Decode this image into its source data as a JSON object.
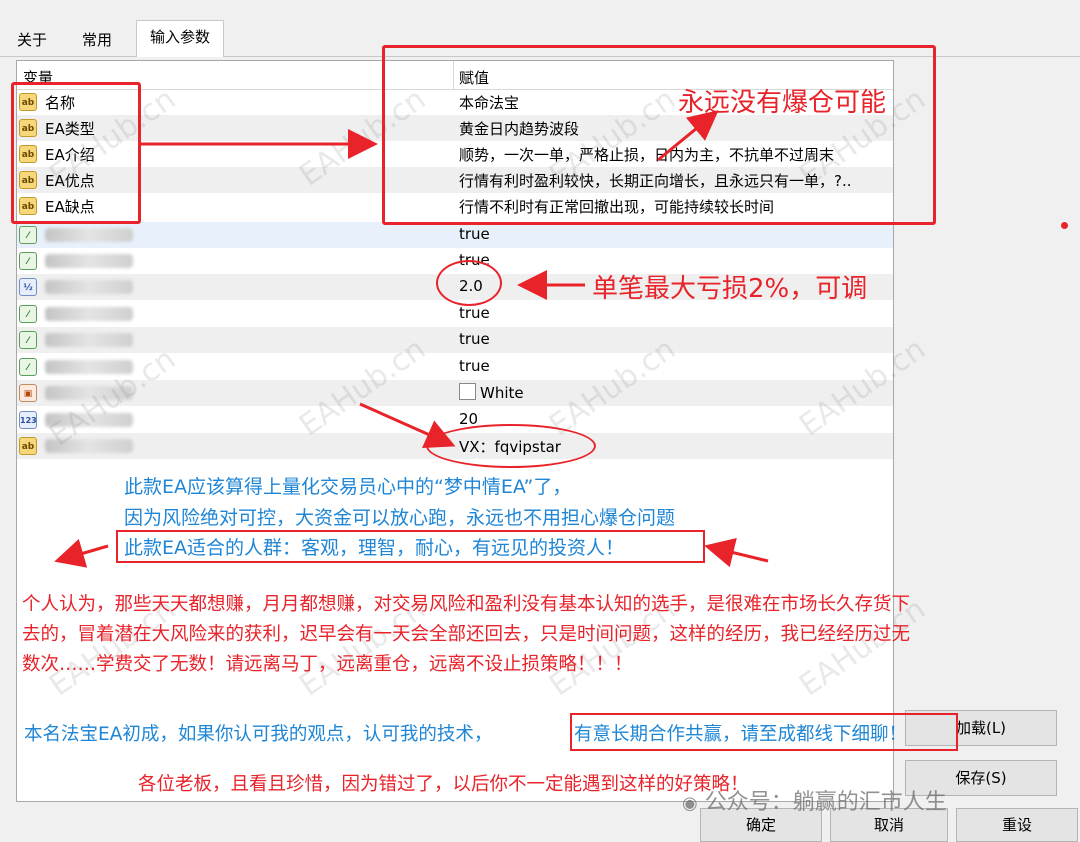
{
  "tabs": [
    {
      "label": "关于"
    },
    {
      "label": "常用"
    },
    {
      "label": "输入参数"
    }
  ],
  "columns": {
    "variable": "变量",
    "value": "赋值"
  },
  "rows": [
    {
      "name": "名称",
      "value": "本命法宝",
      "icon": "ab"
    },
    {
      "name": "EA类型",
      "value": "黄金日内趋势波段",
      "icon": "ab"
    },
    {
      "name": "EA介绍",
      "value": "顺势，一次一单，严格止损，日内为主，不抗单不过周末",
      "icon": "ab"
    },
    {
      "name": "EA优点",
      "value": "行情有利时盈利较快，长期正向增长，且永远只有一单，?..",
      "icon": "ab"
    },
    {
      "name": "EA缺点",
      "value": "行情不利时有正常回撤出现，可能持续较长时间",
      "icon": "ab"
    },
    {
      "name": "",
      "value": "true",
      "icon": "bool"
    },
    {
      "name": "",
      "value": "true",
      "icon": "bool"
    },
    {
      "name": "",
      "value": "2.0",
      "icon": "double"
    },
    {
      "name": "",
      "value": "true",
      "icon": "bool"
    },
    {
      "name": "",
      "value": "true",
      "icon": "bool"
    },
    {
      "name": "",
      "value": "true",
      "icon": "bool"
    },
    {
      "name": "",
      "value": "White",
      "icon": "color"
    },
    {
      "name": "",
      "value": "20",
      "icon": "int"
    },
    {
      "name": "",
      "value": "VX：fqvipstar",
      "icon": "ab"
    }
  ],
  "icon_labels": {
    "ab": "ab",
    "bool": "⁄",
    "double": "½",
    "color": "▣",
    "int": "123"
  },
  "buttons": {
    "load": "加载(L)",
    "save": "保存(S)",
    "ok": "确定",
    "cancel": "取消",
    "reset": "重设"
  },
  "annotations": {
    "never_blowup": "永远没有爆仓可能",
    "max_loss": "单笔最大亏损2%，可调",
    "blue_line1": "此款EA应该算得上量化交易员心中的“梦中情EA”了，",
    "blue_line2": "因为风险绝对可控，大资金可以放心跑，永远也不用担心爆仓问题",
    "blue_line3": "此款EA适合的人群：客观，理智，耐心，有远见的投资人！",
    "red_para1": "个人认为，那些天天都想赚，月月都想赚，对交易风险和盈利没有基本认知的选手，是很难在市场长久存货下",
    "red_para2": "去的，冒着潜在大风险来的获利，迟早会有一天会全部还回去，只是时间问题，这样的经历，我已经经历过无",
    "red_para3": "数次……学费交了无数！请远离马丁，远离重仓，远离不设止损策略！！！",
    "blue_bottom_a": "本名法宝EA初成，如果你认可我的观点，认可我的技术，",
    "blue_bottom_b": "有意长期合作共赢，请至成都线下细聊！",
    "red_bottom": "各位老板，且看且珍惜，因为错过了，以后你不一定能遇到这样的好策略！"
  },
  "watermark": "EAHub.cn",
  "wechat_mark": "公众号：躺赢的汇市人生",
  "colors": {
    "annotation_red": "#e8232a",
    "annotation_blue": "#1f86d6"
  }
}
